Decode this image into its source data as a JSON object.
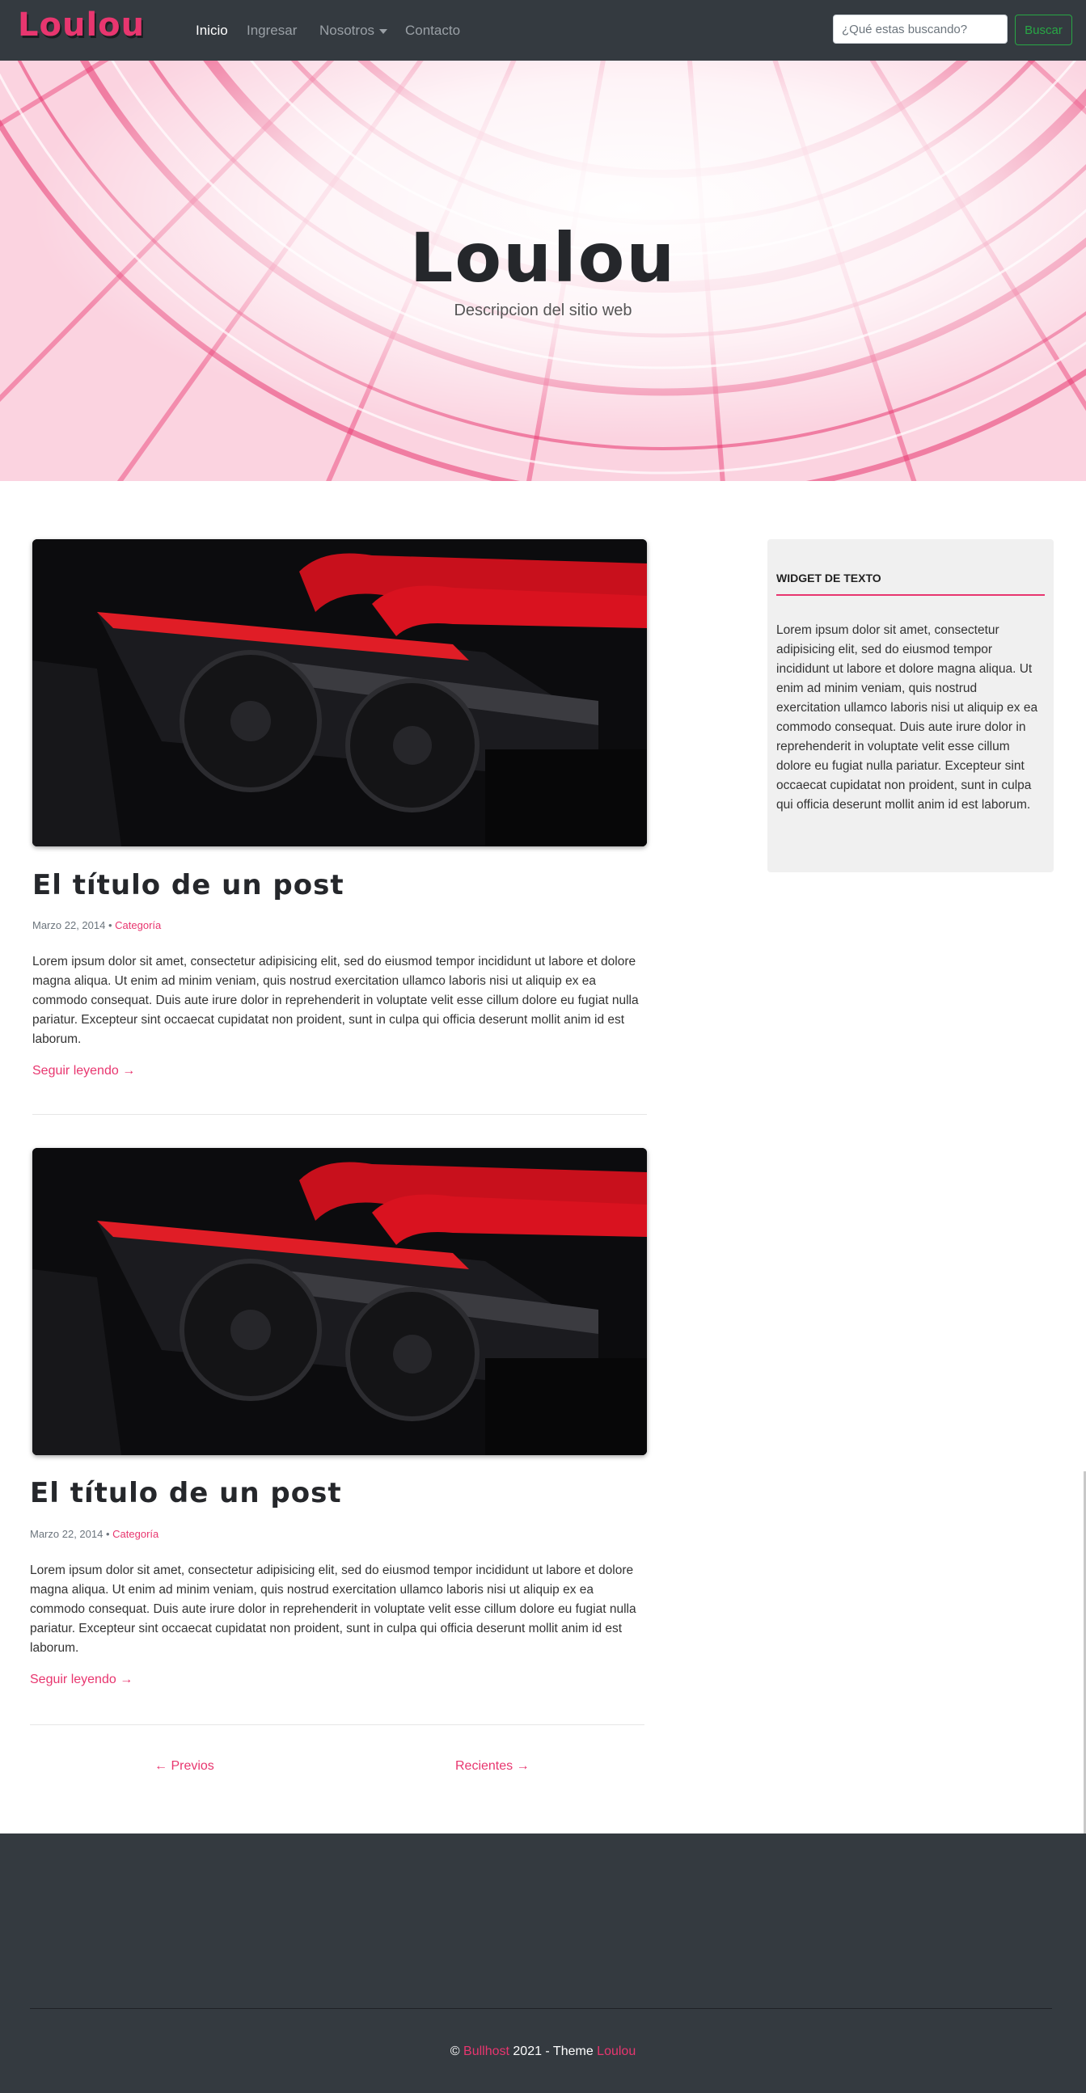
{
  "navbar": {
    "brand": "Loulou",
    "items": [
      {
        "label": "Inicio",
        "active": true
      },
      {
        "label": "Ingresar",
        "active": false
      },
      {
        "label": "Nosotros",
        "active": false,
        "dropdown": true
      },
      {
        "label": "Contacto",
        "active": false
      }
    ],
    "search": {
      "placeholder": "¿Qué estas buscando?",
      "value": ""
    },
    "search_button": "Buscar"
  },
  "hero": {
    "title": "Loulou",
    "subtitle": "Descripcion del sitio web"
  },
  "posts": [
    {
      "title": "El título de un post",
      "date": "Marzo 22, 2014",
      "separator": "•",
      "category": "Categoría",
      "excerpt": "Lorem ipsum dolor sit amet, consectetur adipisicing elit, sed do eiusmod tempor incididunt ut labore et dolore magna aliqua. Ut enim ad minim veniam, quis nostrud exercitation ullamco laboris nisi ut aliquip ex ea commodo consequat. Duis aute irure dolor in reprehenderit in voluptate velit esse cillum dolore eu fugiat nulla pariatur. Excepteur sint occaecat cupidatat non proident, sunt in culpa qui officia deserunt mollit anim id est laborum.",
      "read_more": "Seguir leyendo →"
    },
    {
      "title": "El título de un post",
      "date": "Marzo 22, 2014",
      "separator": "•",
      "category": "Categoría",
      "excerpt": "Lorem ipsum dolor sit amet, consectetur adipisicing elit, sed do eiusmod tempor incididunt ut labore et dolore magna aliqua. Ut enim ad minim veniam, quis nostrud exercitation ullamco laboris nisi ut aliquip ex ea commodo consequat. Duis aute irure dolor in reprehenderit in voluptate velit esse cillum dolore eu fugiat nulla pariatur. Excepteur sint occaecat cupidatat non proident, sunt in culpa qui officia deserunt mollit anim id est laborum.",
      "read_more": "Seguir leyendo →"
    }
  ],
  "pagination": {
    "previous": "← Previos",
    "next": "Recientes →"
  },
  "widget": {
    "title": "WIDGET DE TEXTO",
    "text": "Lorem ipsum dolor sit amet, consectetur adipisicing elit, sed do eiusmod tempor incididunt ut labore et dolore magna aliqua. Ut enim ad minim veniam, quis nostrud exercitation ullamco laboris nisi ut aliquip ex ea commodo consequat. Duis aute irure dolor in reprehenderit in voluptate velit esse cillum dolore eu fugiat nulla pariatur. Excepteur sint occaecat cupidatat non proident, sunt in culpa qui officia deserunt mollit anim id est laborum."
  },
  "footer": {
    "copyright_symbol": "©",
    "company": "Bullhost",
    "year_theme": "2021 - Theme",
    "theme_name": "Loulou"
  },
  "colors": {
    "accent": "#e8366f",
    "navbar_bg": "#343a40",
    "success": "#28a745"
  }
}
